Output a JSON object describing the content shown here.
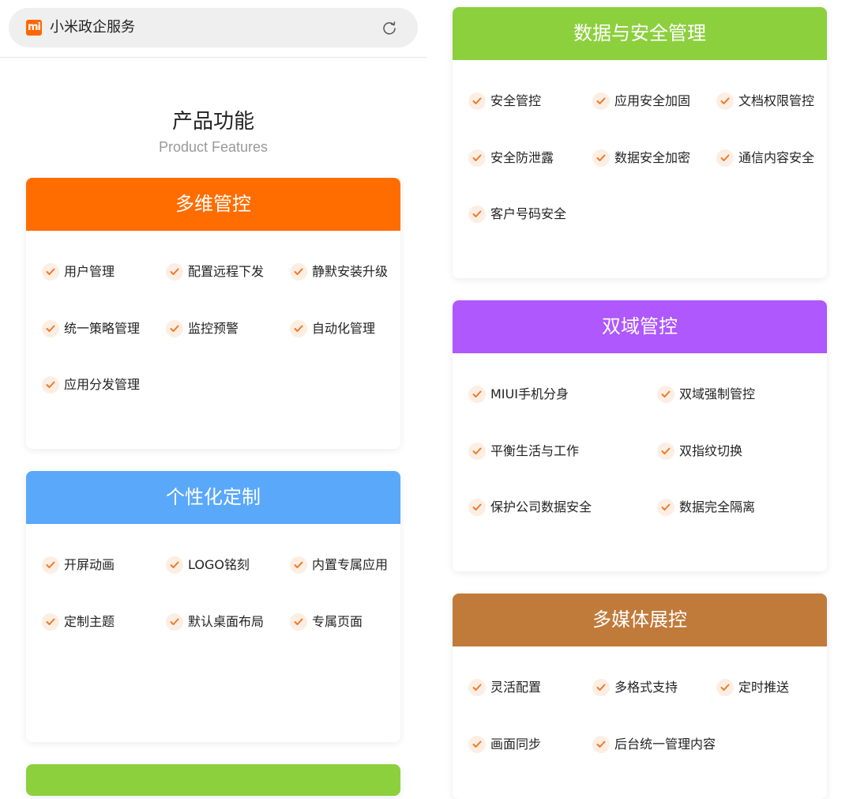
{
  "browser": {
    "title": "小米政企服务",
    "logo_text": "mi"
  },
  "section": {
    "title": "产品功能",
    "subtitle": "Product Features"
  },
  "colors": {
    "orange": "#ff6d00",
    "blue": "#5aa8fa",
    "green": "#8cd03e",
    "purple": "#ae58fd",
    "brown": "#c07a3a",
    "check": "#f07a2a"
  },
  "cards": [
    {
      "title": "多维管控",
      "features": [
        "用户管理",
        "配置远程下发",
        "静默安装升级",
        "统一策略管理",
        "监控预警",
        "自动化管理",
        "应用分发管理"
      ]
    },
    {
      "title": "个性化定制",
      "features": [
        "开屏动画",
        "LOGO铭刻",
        "内置专属应用",
        "定制主题",
        "默认桌面布局",
        "专属页面"
      ]
    },
    {
      "title": "数据与安全管理",
      "features": [
        "安全管控",
        "应用安全加固",
        "文档权限管控",
        "安全防泄露",
        "数据安全加密",
        "通信内容安全",
        "客户号码安全"
      ]
    },
    {
      "title": "双域管控",
      "features": [
        "MIUI手机分身",
        "双域强制管控",
        "平衡生活与工作",
        "双指纹切换",
        "保护公司数据安全",
        "数据完全隔离"
      ]
    },
    {
      "title": "多媒体展控",
      "features": [
        "灵活配置",
        "多格式支持",
        "定时推送",
        "画面同步",
        "后台统一管理内容"
      ]
    }
  ]
}
